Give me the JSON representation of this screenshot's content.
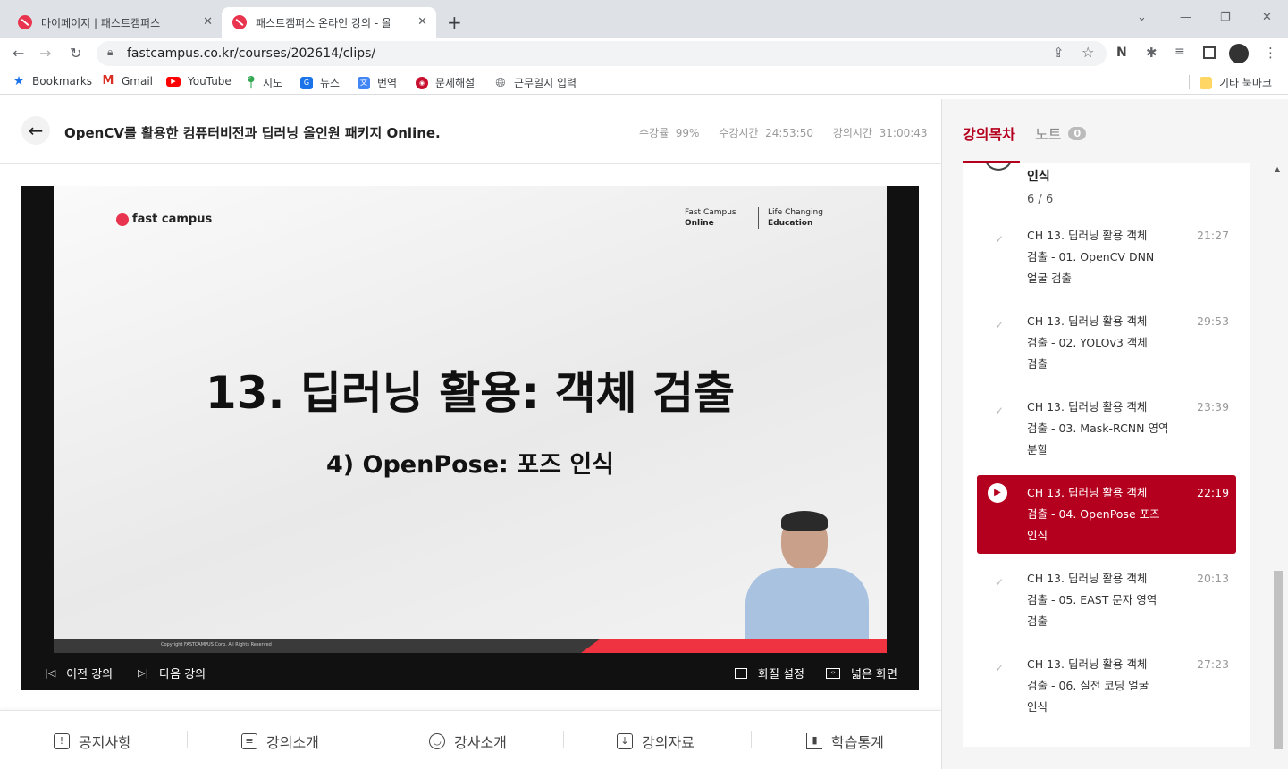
{
  "browser": {
    "tabs": [
      {
        "title": "마이페이지 | 패스트캠퍼스"
      },
      {
        "title": "패스트캠퍼스 온라인 강의 - 올인원"
      }
    ],
    "url": "fastcampus.co.kr/courses/202614/clips/",
    "bookmarks": [
      "Bookmarks",
      "Gmail",
      "YouTube",
      "지도",
      "뉴스",
      "번역",
      "문제해설",
      "근무일지 입력"
    ],
    "other_bookmarks": "기타 북마크"
  },
  "course": {
    "title": "OpenCV를 활용한 컴퓨터비전과 딥러닝 올인원 패키지 Online.",
    "progress_label": "수강률",
    "progress_value": "99%",
    "watch_label": "수강시간",
    "watch_value": "24:53:50",
    "total_label": "강의시간",
    "total_value": "31:00:43"
  },
  "slide": {
    "brand": "fast campus",
    "tag1_line1": "Fast Campus",
    "tag1_line2": "Online",
    "tag2_line1": "Life Changing",
    "tag2_line2": "Education",
    "heading": "13. 딥러닝 활용: 객체 검출",
    "subheading": "4) OpenPose: 포즈 인식",
    "copyright": "Copyright FASTCAMPUS Corp. All Rights Reserved"
  },
  "player": {
    "prev": "이전 강의",
    "next": "다음 강의",
    "quality": "화질 설정",
    "wide": "넓은 화면"
  },
  "bottom_tabs": [
    "공지사항",
    "강의소개",
    "강사소개",
    "강의자료",
    "학습통계"
  ],
  "sidebar": {
    "tab_toc": "강의목차",
    "tab_notes": "노트",
    "notes_count": "0",
    "section_tail": "인식",
    "section_count": "6",
    "section_total": "6",
    "items": [
      {
        "l1": "CH 13. 딥러닝 활용 객체",
        "l2": "검출 - 01. OpenCV DNN",
        "l3": "얼굴 검출",
        "duration": "21:27"
      },
      {
        "l1": "CH 13. 딥러닝 활용 객체",
        "l2": "검출 - 02. YOLOv3 객체",
        "l3": "검출",
        "duration": "29:53"
      },
      {
        "l1": "CH 13. 딥러닝 활용 객체",
        "l2": "검출 - 03. Mask-RCNN 영역",
        "l3": "분할",
        "duration": "23:39"
      },
      {
        "l1": "CH 13. 딥러닝 활용 객체",
        "l2": "검출 - 04. OpenPose 포즈",
        "l3": "인식",
        "duration": "22:19"
      },
      {
        "l1": "CH 13. 딥러닝 활용 객체",
        "l2": "검출 - 05. EAST 문자 영역",
        "l3": "검출",
        "duration": "20:13"
      },
      {
        "l1": "CH 13. 딥러닝 활용 객체",
        "l2": "검출 - 06. 실전 코딩 얼굴",
        "l3": "인식",
        "duration": "27:23"
      }
    ]
  },
  "colors": {
    "accent": "#b4001e",
    "brand_red": "#ef3340"
  }
}
